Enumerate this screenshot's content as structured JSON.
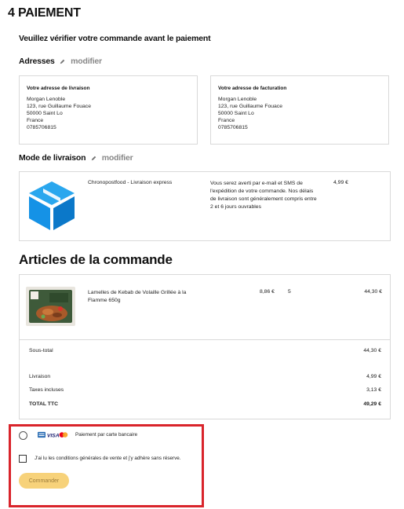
{
  "header": {
    "step_title": "4  PAIEMENT",
    "subtitle": "Veuillez vérifier votre commande avant le paiement"
  },
  "addresses": {
    "heading": "Adresses",
    "modify_label": "modifier",
    "delivery": {
      "title": "Votre adresse de livraison",
      "lines": [
        "Morgan Lenoble",
        "123, rue Guillaume Fouace",
        "50000 Saint Lo",
        "France",
        "0785706815"
      ]
    },
    "billing": {
      "title": "Votre adresse de facturation",
      "lines": [
        "Morgan Lenoble",
        "123, rue Guillaume Fouace",
        "50000 Saint Lo",
        "France",
        "0785706815"
      ]
    }
  },
  "shipping": {
    "heading": "Mode de livraison",
    "modify_label": "modifier",
    "carrier_name": "Chronopostfood - Livraison express",
    "description": "Vous serez averti par e-mail et SMS de l'expédition de votre commande. Nos délais de livraison sont généralement compris entre 2 et 6 jours ouvrables",
    "price": "4,99 €",
    "logo_color": "#1592e6",
    "logo_icon": "open-box-icon"
  },
  "articles": {
    "heading": "Articles de la commande",
    "items": [
      {
        "name": "Lamelles de Kebab de Volaille Grillée à la Flamme 650g",
        "unit_price": "8,86 €",
        "quantity": "5",
        "total": "44,30 €"
      }
    ],
    "summary": {
      "subtotal_label": "Sous-total",
      "subtotal_value": "44,30 €",
      "shipping_label": "Livraison",
      "shipping_value": "4,99 €",
      "tax_label": "Taxes incluses",
      "tax_value": "3,13 €",
      "total_label": "TOTAL TTC",
      "total_value": "49,29 €"
    }
  },
  "payment": {
    "card_option_label": "Paiement par carte bancaire",
    "card_logos": [
      "CB",
      "VISA",
      "mastercard"
    ],
    "cgv_label": "J'ai lu les conditions générales de vente et j'y adhère sans réserve.",
    "order_button": "Commander",
    "highlight_color": "#d9242b",
    "button_color": "#f7d27a"
  }
}
